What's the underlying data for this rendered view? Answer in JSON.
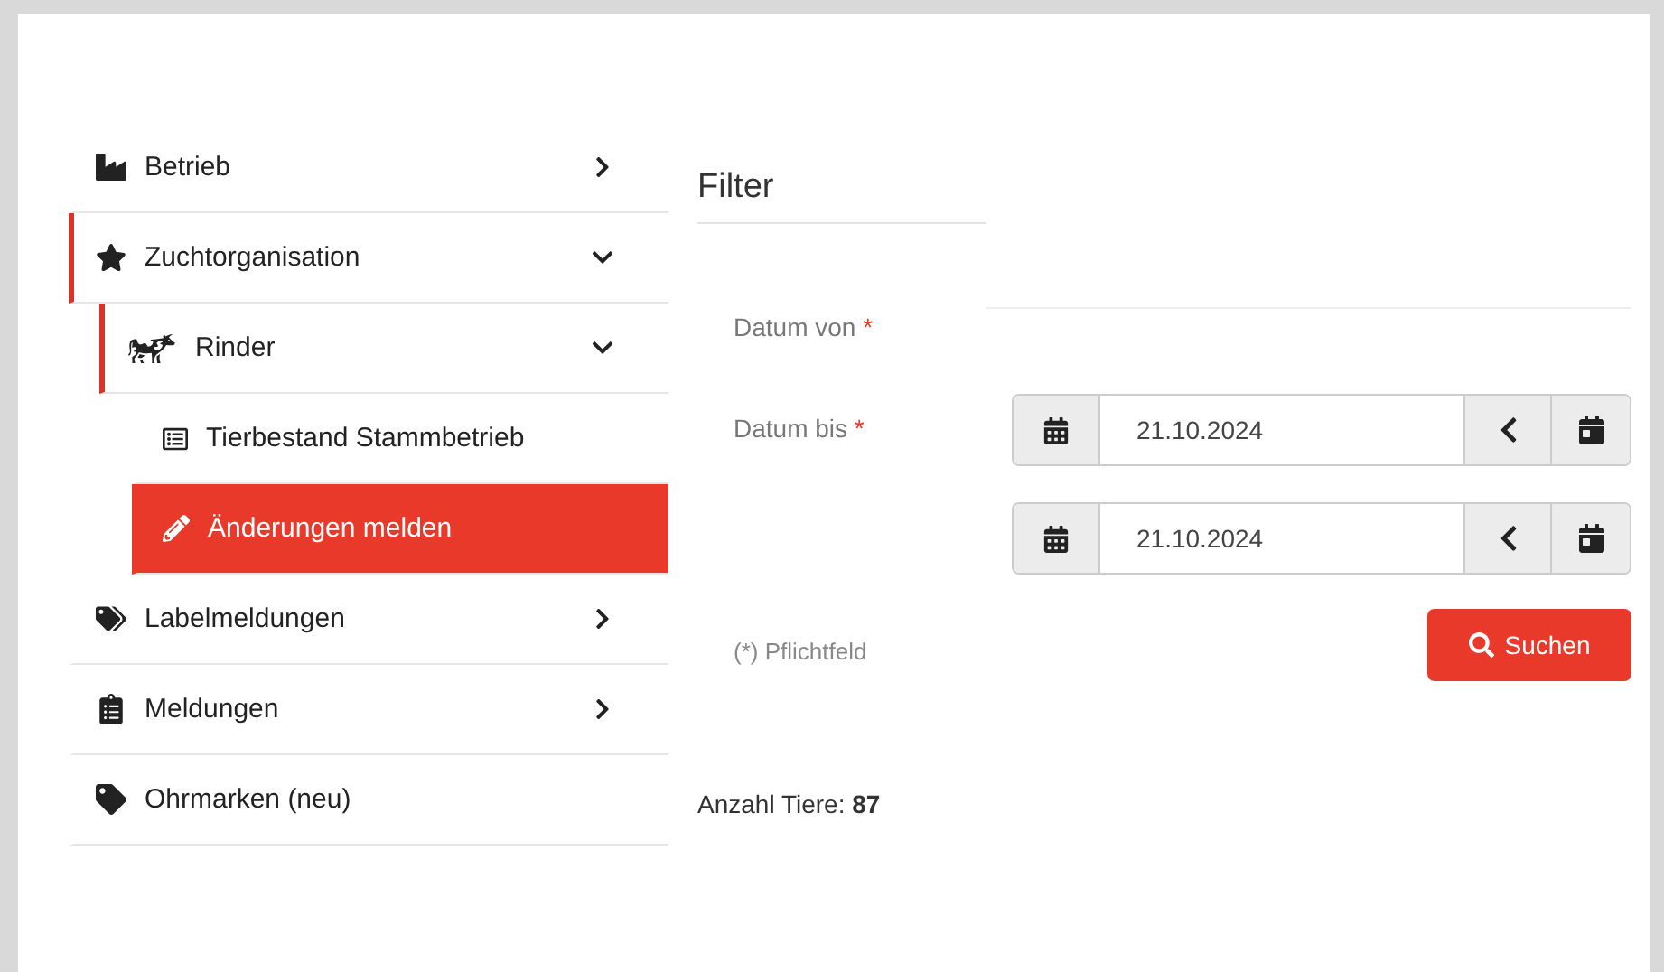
{
  "sidebar": {
    "items": [
      {
        "label": "Betrieb",
        "kind": "group",
        "expanded": false
      },
      {
        "label": "Zuchtorganisation",
        "kind": "group",
        "expanded": true,
        "children": [
          {
            "label": "Rinder",
            "kind": "group",
            "expanded": true,
            "children": [
              {
                "label": "Tierbestand Stammbetrieb",
                "kind": "link",
                "selected": false
              },
              {
                "label": "Änderungen melden",
                "kind": "link",
                "selected": true
              }
            ]
          }
        ]
      },
      {
        "label": "Labelmeldungen",
        "kind": "group",
        "expanded": false
      },
      {
        "label": "Meldungen",
        "kind": "group",
        "expanded": false
      },
      {
        "label": "Ohrmarken (neu)",
        "kind": "link",
        "selected": false
      }
    ]
  },
  "filter": {
    "title": "Filter",
    "labels": [
      {
        "text": "Datum von",
        "required_mark": "*"
      },
      {
        "text": "Datum bis",
        "required_mark": "*"
      }
    ],
    "date_fields": [
      {
        "value": "21.10.2024"
      },
      {
        "value": "21.10.2024"
      }
    ],
    "search_button": "Suchen",
    "required_note": "(*) Pflichtfeld",
    "count": {
      "label": "Anzahl Tiere:",
      "value": "87"
    }
  }
}
